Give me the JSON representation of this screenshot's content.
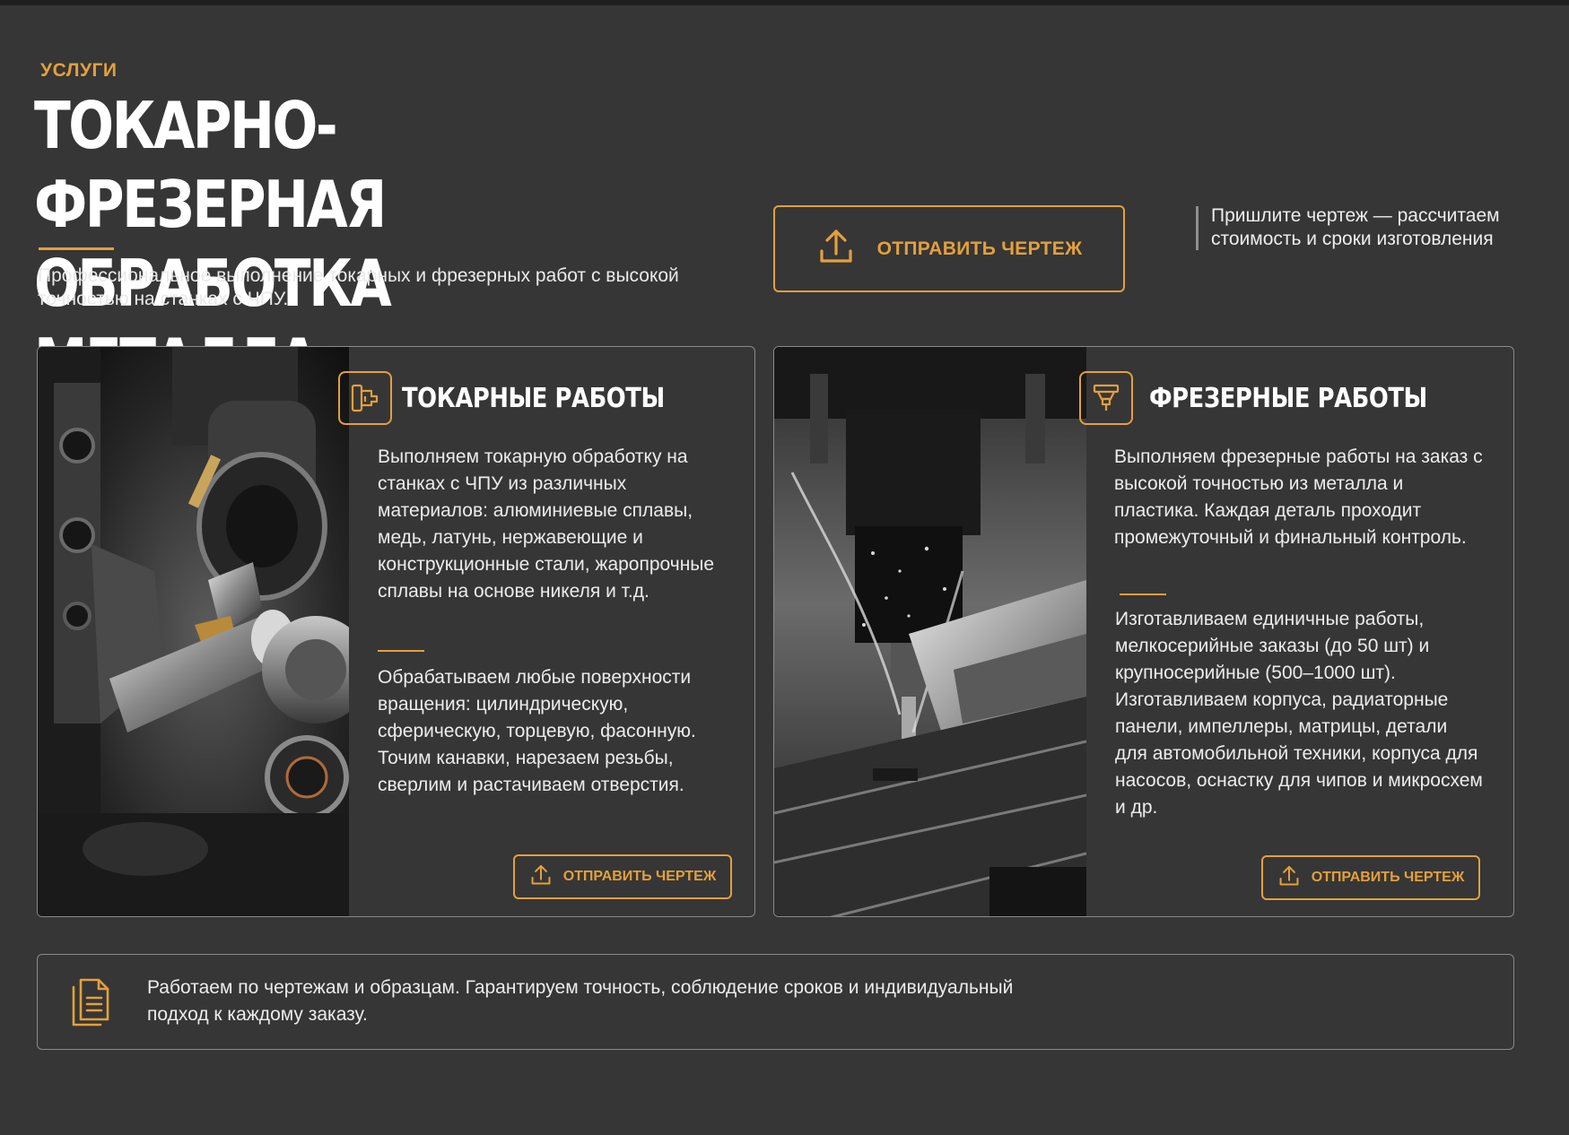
{
  "header": {
    "eyebrow": "УСЛУГИ",
    "title_line1": "ТОКАРНО-ФРЕЗЕРНАЯ",
    "title_line2": "ОБРАБОТКА МЕТАЛЛА",
    "lead": "Профессиональное выполнение токарных и фрезерных работ с высокой точностью на станках с ЧПУ."
  },
  "cta": {
    "label": "ОТПРАВИТЬ ЧЕРТЕЖ",
    "icon": "upload-icon",
    "aside": "Пришлите чертеж — рассчитаем стоимость и сроки изготовления"
  },
  "cards": [
    {
      "icon": "lathe-icon",
      "title": "ТОКАРНЫЕ РАБОТЫ",
      "paragraph1": "Выполняем токарную обработку на станках с ЧПУ из различных материалов: алюминиевые сплавы, медь, латунь, нержавеющие и конструкционные стали, жаропрочные сплавы на основе никеля и т.д.",
      "paragraph2": "Обрабатываем любые поверхности вращения: цилиндрическую, сферическую, торцевую, фасонную. Точим канавки, нарезаем резьбы, сверлим и растачиваем отверстия.",
      "button": "ОТПРАВИТЬ ЧЕРТЕЖ"
    },
    {
      "icon": "milling-icon",
      "title": "ФРЕЗЕРНЫЕ РАБОТЫ",
      "paragraph1": "Выполняем фрезерные работы на заказ с высокой точностью из металла и пластика. Каждая деталь проходит промежуточный и финальный контроль.",
      "paragraph2": "Изготавливаем единичные работы, мелкосерийные заказы (до 50 шт)  и крупносерийные (500–1000 шт). Изготавливаем корпуса, радиаторные панели, импеллеры, матрицы, детали для автомобильной техники, корпуса для насосов, оснастку для чипов  и микросхем и др.",
      "button": "ОТПРАВИТЬ ЧЕРТЕЖ"
    }
  ],
  "footer": {
    "icon": "document-icon",
    "text": "Работаем по чертежам и образцам. Гарантируем точность, соблюдение сроков и индивидуальный подход к каждому заказу."
  },
  "colors": {
    "accent": "#e4a03a",
    "background": "#363637",
    "border": "#8a8a8a",
    "text": "#ececec"
  }
}
